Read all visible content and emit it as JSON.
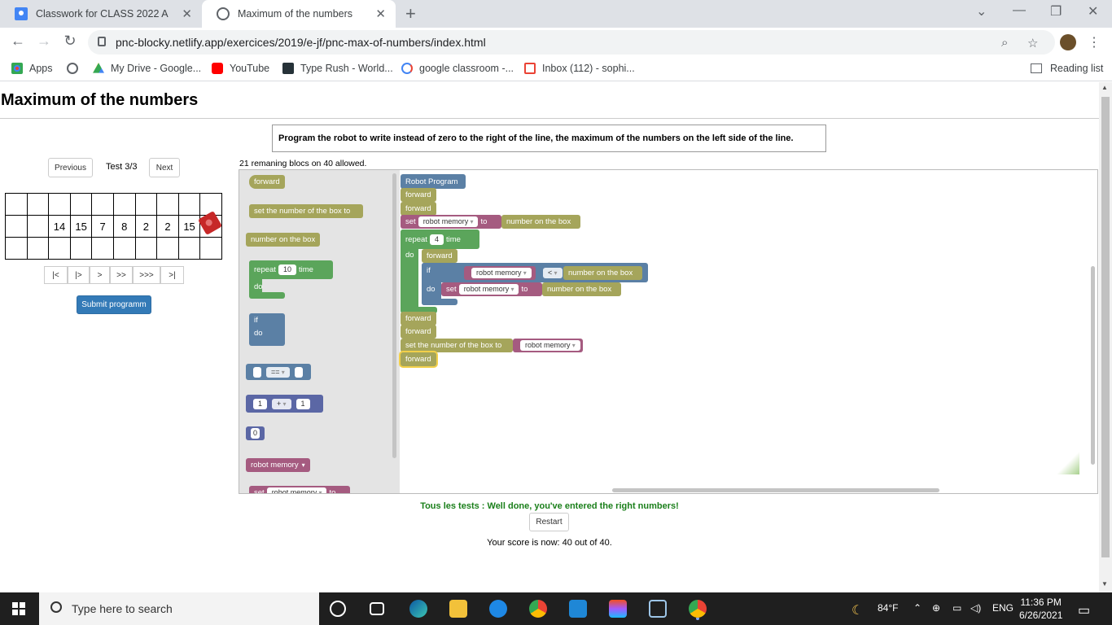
{
  "browser": {
    "tabs": [
      {
        "label": "Classwork for CLASS 2022 A",
        "active": false
      },
      {
        "label": "Maximum of the numbers",
        "active": true
      }
    ],
    "url": "pnc-blocky.netlify.app/exercices/2019/e-jf/pnc-max-of-numbers/index.html",
    "bookmarks": [
      "Apps",
      "My Drive - Google...",
      "YouTube",
      "Type Rush - World...",
      "google classroom -...",
      "Inbox (112) - sophi..."
    ],
    "reading_list": "Reading list"
  },
  "page": {
    "title": "Maximum of the numbers",
    "instruction": "Program the robot to write instead of zero to the right of the line, the maximum of the numbers on the left side of the line.",
    "previous_label": "Previous",
    "test_label": "Test 3/3",
    "next_label": "Next",
    "grid_row": [
      "",
      "14",
      "15",
      "7",
      "8",
      "2",
      "2",
      "15",
      ""
    ],
    "nav_buttons": [
      "|<",
      "|>",
      ">",
      ">>",
      ">>>",
      ">|"
    ],
    "submit_label": "Submit programm",
    "remaining": "21 remaning blocs on 40 allowed.",
    "success": "Tous les tests : Well done, you've entered the right numbers!",
    "restart_label": "Restart",
    "score": "Your score is now: 40 out of 40."
  },
  "toolbox": {
    "forward": "forward",
    "set_box": "set the number of the box to",
    "number_on_box": "number on the box",
    "repeat": "repeat",
    "repeat_count": "10",
    "time": "time",
    "do": "do",
    "if": "if",
    "compare_op": "==",
    "math_left": "1",
    "math_op": "+",
    "math_right": "1",
    "number": "0",
    "robot_memory": "robot memory",
    "set": "set",
    "to": "to"
  },
  "program": {
    "header": "Robot Program",
    "forward": "forward",
    "set": "set",
    "robot_memory": "robot memory",
    "to": "to",
    "number_on_box": "number on the box",
    "repeat": "repeat",
    "repeat_count": "4",
    "time": "time",
    "do": "do",
    "if": "if",
    "compare_op": "<",
    "set_box": "set the number of the box to"
  },
  "taskbar": {
    "search_placeholder": "Type here to search",
    "weather": "84°F",
    "lang": "ENG",
    "time": "11:36 PM",
    "date": "6/26/2021"
  },
  "colors": {
    "motion": "#a5a55b",
    "variable": "#a55b80",
    "loop": "#5ba55b",
    "logic": "#5b80a5",
    "math": "#5b67a5",
    "success": "#1a7f1a",
    "submit": "#337ab7"
  }
}
